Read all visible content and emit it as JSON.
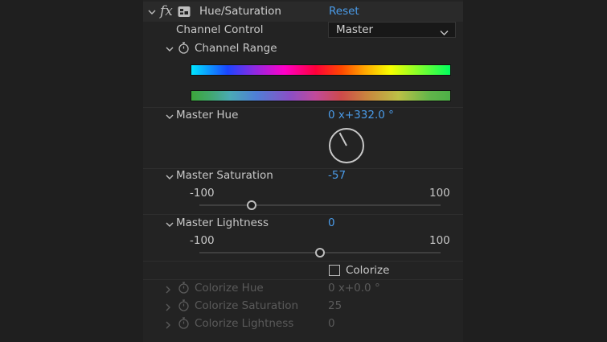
{
  "effect": {
    "fx_label": "fx",
    "name": "Hue/Saturation",
    "reset_label": "Reset"
  },
  "channel_control": {
    "label": "Channel Control",
    "selected": "Master"
  },
  "channel_range": {
    "label": "Channel Range"
  },
  "master_hue": {
    "label": "Master Hue",
    "value": "0 x+332.0 °",
    "angle_degrees": 332
  },
  "master_saturation": {
    "label": "Master Saturation",
    "value": "-57",
    "min_label": "-100",
    "max_label": "100",
    "min": -100,
    "max": 100,
    "current": -57
  },
  "master_lightness": {
    "label": "Master Lightness",
    "value": "0",
    "min_label": "-100",
    "max_label": "100",
    "min": -100,
    "max": 100,
    "current": 0
  },
  "colorize": {
    "label": "Colorize",
    "checked": false
  },
  "colorize_hue": {
    "label": "Colorize Hue",
    "value": "0 x+0.0 °"
  },
  "colorize_saturation": {
    "label": "Colorize Saturation",
    "value": "25"
  },
  "colorize_lightness": {
    "label": "Colorize Lightness",
    "value": "0"
  },
  "colors": {
    "panel_bg": "#232323",
    "value_blue": "#4a9be8",
    "disabled_text": "#5a5a5a"
  },
  "icons": [
    "chevron-down-icon",
    "chevron-right-icon",
    "stopwatch-icon",
    "effect-badge-icon",
    "dropdown-caret-icon"
  ]
}
